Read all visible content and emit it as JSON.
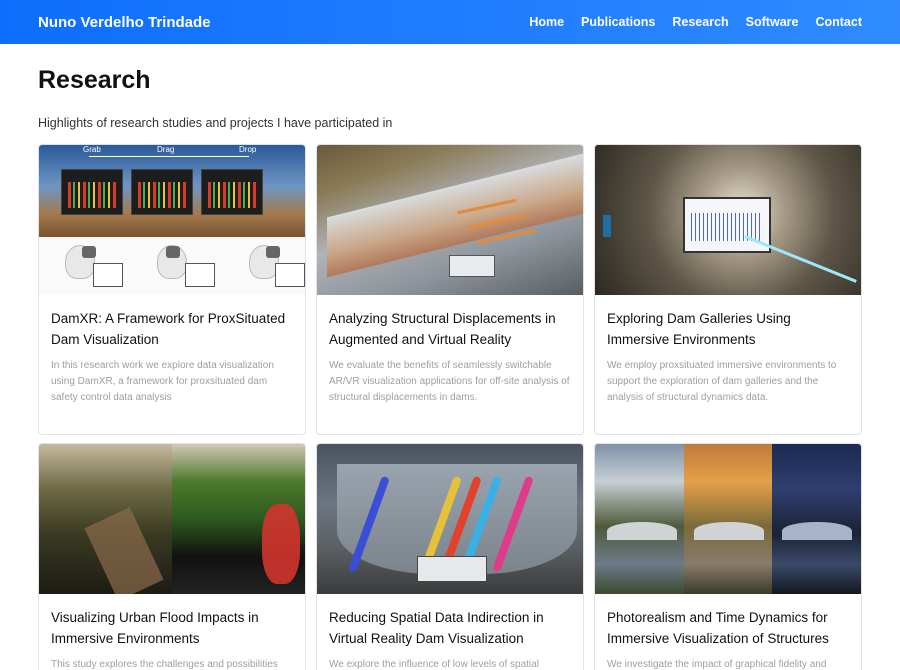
{
  "nav": {
    "brand": "Nuno Verdelho Trindade",
    "links": [
      "Home",
      "Publications",
      "Research",
      "Software",
      "Contact"
    ]
  },
  "page": {
    "title": "Research",
    "subtitle": "Highlights of research studies and projects I have participated in"
  },
  "cards": [
    {
      "title": "DamXR: A Framework for ProxSituated Dam Visualization",
      "text": "In this research work we explore data visualization using DamXR, a framework for proxsituated dam safety control data analysis",
      "image_labels": [
        "Grab",
        "Drag",
        "Drop"
      ]
    },
    {
      "title": "Analyzing Structural Displacements in Augmented and Virtual Reality",
      "text": "We evaluate the benefits of seamlessly switchable AR/VR visualization applications for off-site analysis of structural displacements in dams."
    },
    {
      "title": "Exploring Dam Galleries Using Immersive Environments",
      "text": "We employ proxsituated immersive environments to support the exploration of dam galleries and the analysis of structural dynamics data."
    },
    {
      "title": "Visualizing Urban Flood Impacts in Immersive Environments",
      "text": "This study explores the challenges and possibilities"
    },
    {
      "title": "Reducing Spatial Data Indirection in Virtual Reality Dam Visualization",
      "text": "We explore the influence of low levels of spatial"
    },
    {
      "title": "Photorealism and Time Dynamics for Immersive Visualization of Structures",
      "text": "We investigate the impact of graphical fidelity and"
    }
  ]
}
